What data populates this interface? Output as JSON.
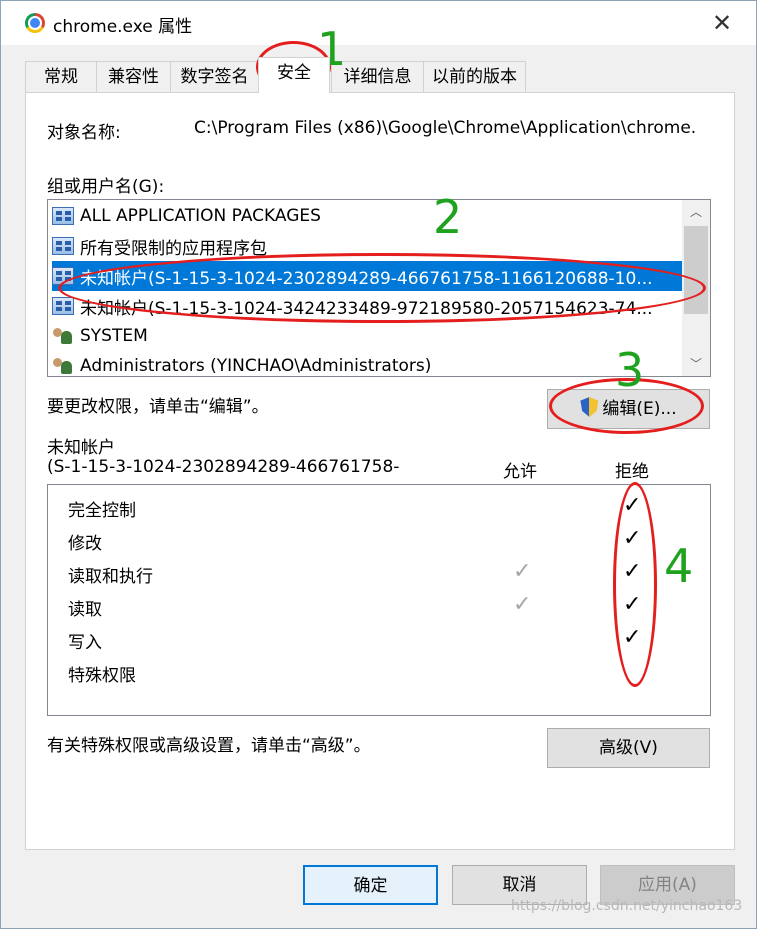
{
  "window": {
    "title": "chrome.exe 属性",
    "close_glyph": "✕"
  },
  "tabs": [
    {
      "label": "常规"
    },
    {
      "label": "兼容性"
    },
    {
      "label": "数字签名"
    },
    {
      "label": "安全"
    },
    {
      "label": "详细信息"
    },
    {
      "label": "以前的版本"
    }
  ],
  "object": {
    "label": "对象名称:",
    "value": "C:\\Program Files (x86)\\Google\\Chrome\\Application\\chrome."
  },
  "groups": {
    "label": "组或用户名(G):",
    "items": [
      {
        "icon": "package-icon",
        "label": "ALL APPLICATION PACKAGES"
      },
      {
        "icon": "package-icon",
        "label": "所有受限制的应用程序包"
      },
      {
        "icon": "package-icon",
        "label": "未知帐户(S-1-15-3-1024-2302894289-466761758-1166120688-10...",
        "selected": true
      },
      {
        "icon": "package-icon",
        "label": "未知帐户(S-1-15-3-1024-3424233489-972189580-2057154623-74..."
      },
      {
        "icon": "users-icon",
        "label": "SYSTEM"
      },
      {
        "icon": "users-icon",
        "label": "Administrators (YINCHAO\\Administrators)"
      }
    ]
  },
  "edit_hint": "要更改权限，请单击“编辑”。",
  "edit_button": "编辑(E)...",
  "perm_header": {
    "account_line1": "未知帐户",
    "account_line2": "(S-1-15-3-1024-2302894289-466761758-",
    "allow": "允许",
    "deny": "拒绝"
  },
  "permissions": [
    {
      "label": "完全控制",
      "allow": false,
      "deny": true
    },
    {
      "label": "修改",
      "allow": false,
      "deny": true
    },
    {
      "label": "读取和执行",
      "allow": true,
      "deny": true
    },
    {
      "label": "读取",
      "allow": true,
      "deny": true
    },
    {
      "label": "写入",
      "allow": false,
      "deny": true
    },
    {
      "label": "特殊权限",
      "allow": false,
      "deny": false
    }
  ],
  "check_glyph": "✓",
  "advanced_hint": "有关特殊权限或高级设置，请单击“高级”。",
  "advanced_button": "高级(V)",
  "footer": {
    "ok": "确定",
    "cancel": "取消",
    "apply": "应用(A)"
  },
  "annotations": {
    "n1": "1",
    "n2": "2",
    "n3": "3",
    "n4": "4"
  },
  "watermark": "https://blog.csdn.net/yinchao163",
  "colors": {
    "selection": "#0078d7",
    "annotation_oval": "#e41d1d",
    "annotation_number": "#1fa31f"
  }
}
